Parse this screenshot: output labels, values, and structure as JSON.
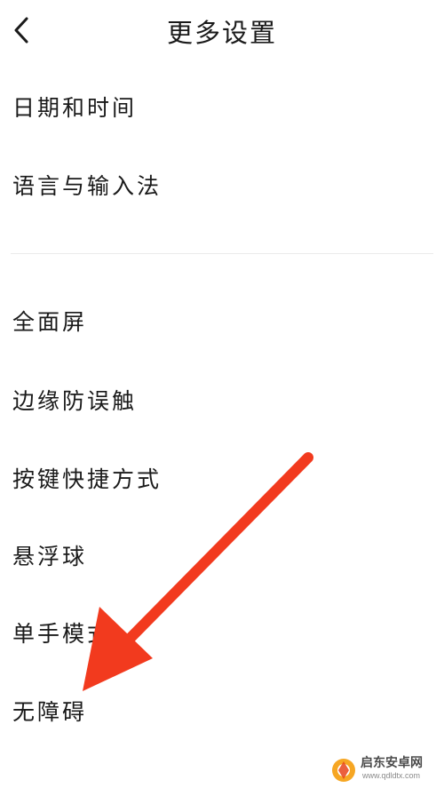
{
  "header": {
    "title": "更多设置",
    "back_icon": "chevron-left-icon"
  },
  "group1": {
    "items": [
      {
        "label": "日期和时间"
      },
      {
        "label": "语言与输入法"
      }
    ]
  },
  "group2": {
    "items": [
      {
        "label": "全面屏"
      },
      {
        "label": "边缘防误触"
      },
      {
        "label": "按键快捷方式"
      },
      {
        "label": "悬浮球"
      },
      {
        "label": "单手模式"
      },
      {
        "label": "无障碍"
      }
    ]
  },
  "annotation": {
    "arrow_color": "#f23a1e",
    "target": "无障碍"
  },
  "watermark": {
    "name": "启东安卓网",
    "url": "www.qdldtx.com",
    "icon": "watermark-logo-icon"
  }
}
